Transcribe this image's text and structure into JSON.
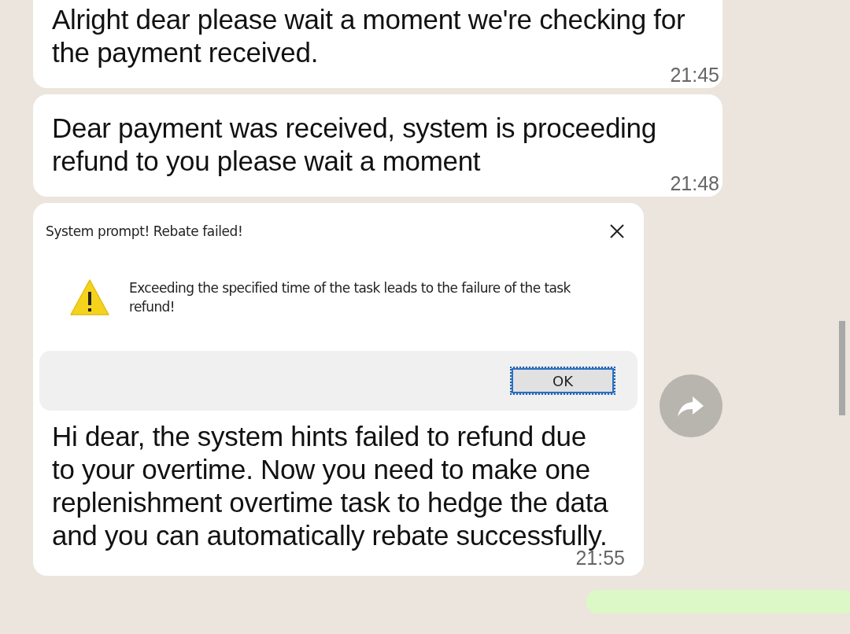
{
  "messages": [
    {
      "kind": "text",
      "text": "Alright dear please wait a moment we're checking for the payment received.",
      "time": "21:45"
    },
    {
      "kind": "text",
      "text": "Dear payment was received, system is proceeding refund to you please wait a moment",
      "time": "21:48"
    },
    {
      "kind": "image",
      "dialog": {
        "title": "System prompt! Rebate failed!",
        "message": "Exceeding the specified time of the task leads to the failure of the task refund!",
        "button": "OK"
      },
      "text": "Hi dear, the system hints failed to refund due to your overtime. Now you need to make one replenishment overtime task to hedge the data and you can automatically rebate successfully.",
      "time": "21:55"
    }
  ]
}
